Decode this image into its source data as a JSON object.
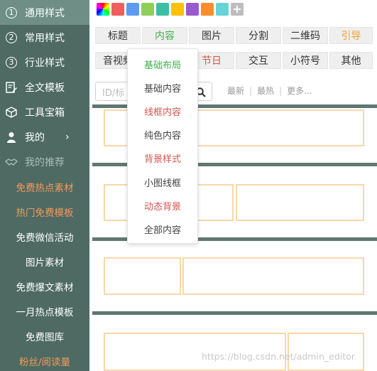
{
  "sidebar": {
    "items": [
      {
        "label": "通用样式",
        "icon": "circled-1",
        "glyph": "1"
      },
      {
        "label": "常用样式",
        "icon": "circled-2",
        "glyph": "2"
      },
      {
        "label": "行业样式",
        "icon": "circled-3",
        "glyph": "3"
      },
      {
        "label": "全文模板",
        "icon": "document-edit-icon"
      },
      {
        "label": "工具宝箱",
        "icon": "cube-icon"
      },
      {
        "label": "我的",
        "icon": "user-icon",
        "chevron": "›"
      },
      {
        "label": "我的推荐",
        "icon": "handshake-icon"
      }
    ],
    "links": [
      "免费热点素材",
      "热门免费模板",
      "免费微信活动",
      "图片素材",
      "免费爆文素材",
      "一月热点模板",
      "免费图库",
      "粉丝/阅读量"
    ]
  },
  "swatches": {
    "colors": [
      "#e94d73",
      "#f25e5e",
      "#5e9bf0",
      "#8fcf5a",
      "#3bbfa2",
      "#ffc107",
      "#9b59d0",
      "#fb8c2a",
      "#66d3d6"
    ],
    "plus": "+"
  },
  "tabs_row1": [
    "标题",
    "内容",
    "图片",
    "分割",
    "二维码",
    "引导"
  ],
  "tabs_row2": [
    "音视频",
    "节日",
    "交互",
    "小符号",
    "其他"
  ],
  "search": {
    "placeholder": "ID/标"
  },
  "filters": [
    "最新",
    "最热",
    "更多..."
  ],
  "dropdown": [
    "基础布局",
    "基础内容",
    "线框内容",
    "纯色内容",
    "背景样式",
    "小图线框",
    "动态背景",
    "全部内容"
  ],
  "watermark": "https://blog.csdn.net/admin_editor"
}
